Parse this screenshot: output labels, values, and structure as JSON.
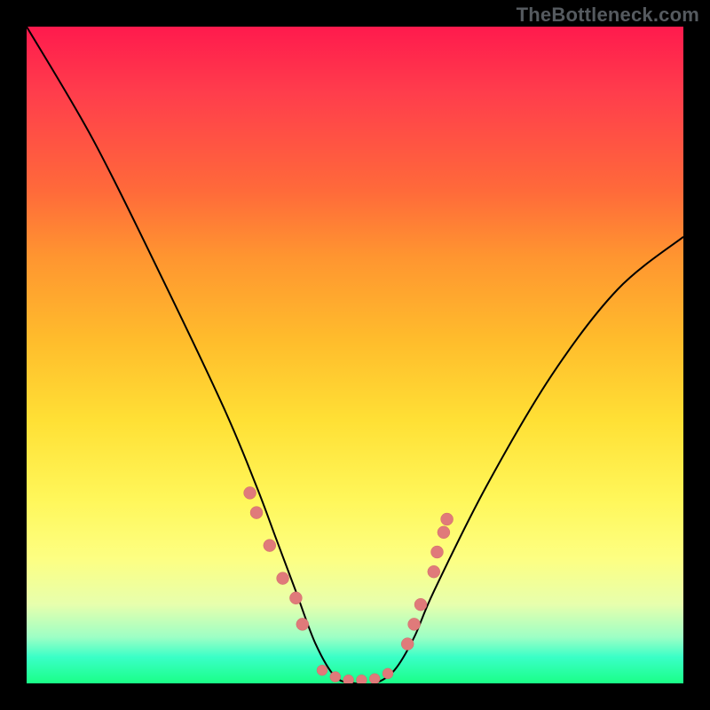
{
  "watermark": "TheBottleneck.com",
  "chart_data": {
    "type": "line",
    "title": "",
    "xlabel": "",
    "ylabel": "",
    "xlim": [
      0,
      100
    ],
    "ylim": [
      0,
      100
    ],
    "grid": false,
    "series": [
      {
        "name": "curve",
        "x": [
          0,
          10,
          20,
          30,
          35,
          38,
          41,
          44,
          47,
          50,
          53,
          56,
          59,
          62,
          70,
          80,
          90,
          100
        ],
        "values": [
          100,
          83,
          63,
          42,
          30,
          22,
          14,
          6,
          1,
          0,
          0,
          2,
          7,
          14,
          30,
          47,
          60,
          68
        ]
      }
    ],
    "marker_clusters": {
      "left_descent": [
        [
          34,
          29
        ],
        [
          35,
          26
        ],
        [
          37,
          21
        ],
        [
          39,
          16
        ],
        [
          41,
          13
        ],
        [
          42,
          9
        ]
      ],
      "bottom_flat": [
        [
          45,
          2
        ],
        [
          47,
          1
        ],
        [
          49,
          0.5
        ],
        [
          51,
          0.5
        ],
        [
          53,
          0.7
        ],
        [
          55,
          1.5
        ]
      ],
      "right_ascent": [
        [
          58,
          6
        ],
        [
          59,
          9
        ],
        [
          60,
          12
        ],
        [
          62,
          17
        ],
        [
          62.5,
          20
        ],
        [
          63.5,
          23
        ],
        [
          64,
          25
        ]
      ]
    }
  }
}
